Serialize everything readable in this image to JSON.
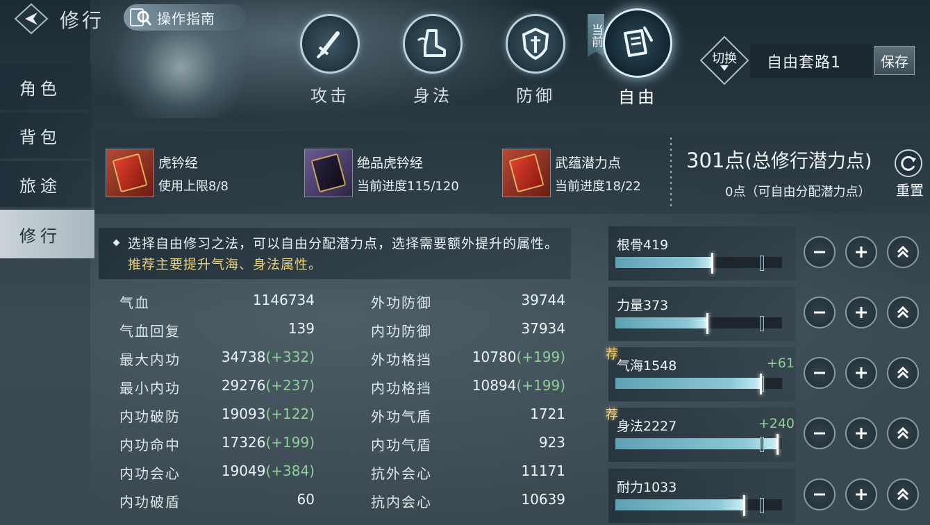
{
  "header": {
    "title": "修行",
    "guide_label": "操作指南"
  },
  "sidebar": {
    "items": [
      {
        "label": "角色"
      },
      {
        "label": "背包"
      },
      {
        "label": "旅途"
      },
      {
        "label": "修行",
        "active": true
      }
    ]
  },
  "categories": [
    {
      "label": "攻击",
      "icon": "sword-icon"
    },
    {
      "label": "身法",
      "icon": "boot-icon"
    },
    {
      "label": "防御",
      "icon": "shield-icon"
    },
    {
      "label": "自由",
      "icon": "scroll-brush-icon",
      "active": true
    }
  ],
  "current_tag": "当前",
  "preset": {
    "switch_label": "切换",
    "name": "自由套路1",
    "save_label": "保存"
  },
  "items": [
    {
      "name": "虎钤经",
      "sub": "使用上限8/8",
      "rarity": "red"
    },
    {
      "name": "绝品虎钤经",
      "sub": "当前进度115/120",
      "rarity": "purple"
    },
    {
      "name": "武蕴潜力点",
      "sub": "当前进度18/22",
      "rarity": "red"
    }
  ],
  "points": {
    "total_value": "301点",
    "total_desc": "(总修行潜力点)",
    "free": "0点（可自由分配潜力点）",
    "reset_label": "重置"
  },
  "tip": {
    "text": "选择自由修习之法，可以自由分配潜力点，选择需要额外提升的属性。",
    "highlight": "推荐主要提升气海、身法属性。"
  },
  "stats": [
    {
      "a_label": "气血",
      "a_value": "1146734",
      "a_bonus": "",
      "b_label": "外功防御",
      "b_value": "39744",
      "b_bonus": ""
    },
    {
      "a_label": "气血回复",
      "a_value": "139",
      "a_bonus": "",
      "b_label": "内功防御",
      "b_value": "37934",
      "b_bonus": ""
    },
    {
      "a_label": "最大内功",
      "a_value": "34738",
      "a_bonus": "(+332)",
      "b_label": "外功格挡",
      "b_value": "10780",
      "b_bonus": "(+199)"
    },
    {
      "a_label": "最小内功",
      "a_value": "29276",
      "a_bonus": "(+237)",
      "b_label": "内功格挡",
      "b_value": "10894",
      "b_bonus": "(+199)"
    },
    {
      "a_label": "内功破防",
      "a_value": "19093",
      "a_bonus": "(+122)",
      "b_label": "外功气盾",
      "b_value": "1721",
      "b_bonus": ""
    },
    {
      "a_label": "内功命中",
      "a_value": "17326",
      "a_bonus": "(+199)",
      "b_label": "内功气盾",
      "b_value": "923",
      "b_bonus": ""
    },
    {
      "a_label": "内功会心",
      "a_value": "19049",
      "a_bonus": "(+384)",
      "b_label": "抗外会心",
      "b_value": "11171",
      "b_bonus": ""
    },
    {
      "a_label": "内功破盾",
      "a_value": "60",
      "a_bonus": "",
      "b_label": "抗内会心",
      "b_value": "10639",
      "b_bonus": ""
    }
  ],
  "attributes": [
    {
      "name": "根骨419",
      "plus": "",
      "recommended": false,
      "fill": 0.58,
      "mark": 0.88
    },
    {
      "name": "力量373",
      "plus": "",
      "recommended": false,
      "fill": 0.55,
      "mark": 0.88
    },
    {
      "name": "气海1548",
      "plus": "+61",
      "recommended": true,
      "fill": 0.87,
      "mark": 0.88
    },
    {
      "name": "身法2227",
      "plus": "+240",
      "recommended": true,
      "fill": 0.97,
      "mark": 0.88
    },
    {
      "name": "耐力1033",
      "plus": "",
      "recommended": false,
      "fill": 0.77,
      "mark": 0.88
    }
  ],
  "rec_label": "荐"
}
